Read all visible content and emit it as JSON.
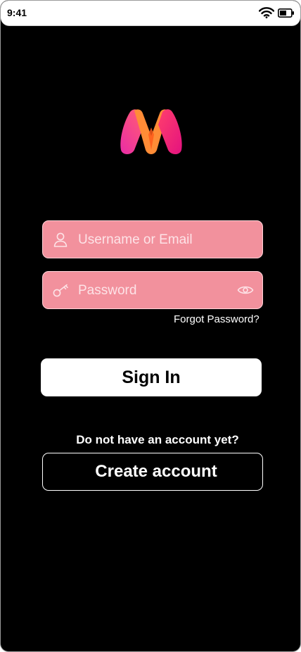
{
  "status_bar": {
    "time": "9:41",
    "icons": [
      "wifi-icon",
      "battery-icon"
    ]
  },
  "brand": {
    "logo_icon": "myntra-m-logo",
    "colors": [
      "#ff3f6c",
      "#ff905a",
      "#e4187f"
    ]
  },
  "login": {
    "username_placeholder": "Username or Email",
    "password_placeholder": "Password",
    "forgot_password": "Forgot Password?",
    "sign_in": "Sign In",
    "no_account_prompt": "Do not have an account yet?",
    "create_account": "Create account"
  },
  "colors": {
    "background": "#000000",
    "field_fill": "#f2919d",
    "button_fill": "#ffffff"
  }
}
